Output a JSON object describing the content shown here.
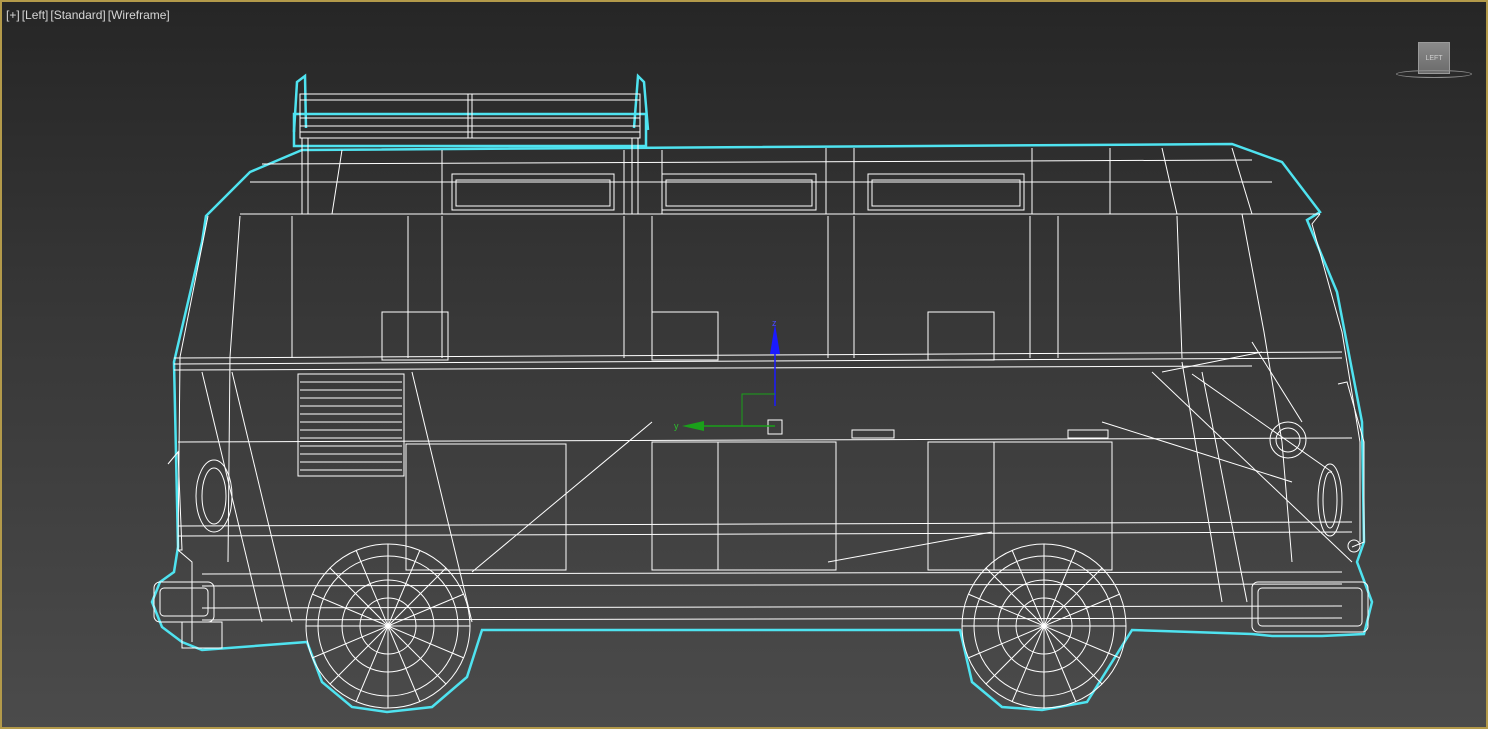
{
  "viewport": {
    "label_plus": "[+]",
    "label_view": "[Left]",
    "label_shading": "[Standard]",
    "label_mode": "[Wireframe]"
  },
  "viewcube": {
    "face_label": "LEFT"
  },
  "gizmo": {
    "z_label": "z",
    "y_label": "y",
    "z_color": "#1a1aff",
    "y_color": "#1aa01a"
  },
  "colors": {
    "border": "#b39a4a",
    "wire": "#ffffff",
    "selection_outline": "#4fe3f0"
  },
  "object": {
    "icon": "van-wireframe-model"
  }
}
